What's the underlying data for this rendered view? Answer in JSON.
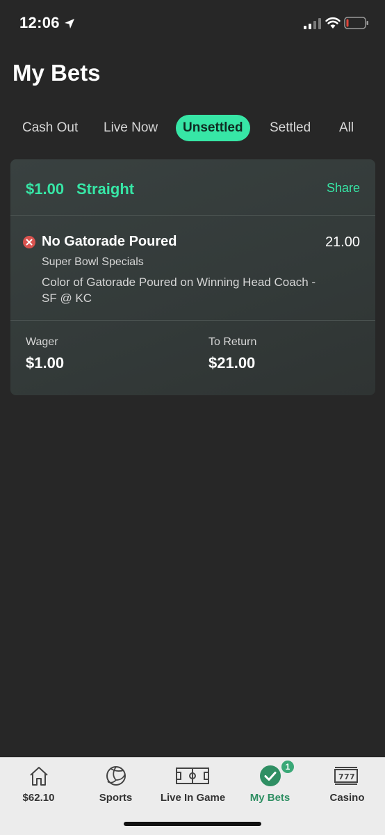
{
  "status_bar": {
    "time": "12:06",
    "icons": [
      "location-arrow-icon",
      "cellular-signal-icon",
      "wifi-icon",
      "battery-low-icon"
    ]
  },
  "page": {
    "title": "My Bets"
  },
  "tabs": [
    {
      "label": "Cash Out",
      "active": false
    },
    {
      "label": "Live Now",
      "active": false
    },
    {
      "label": "Unsettled",
      "active": true
    },
    {
      "label": "Settled",
      "active": false
    },
    {
      "label": "All",
      "active": false
    }
  ],
  "bet": {
    "stake": "$1.00",
    "type": "Straight",
    "share_label": "Share",
    "selection": {
      "status_icon": "lost-x-icon",
      "name": "No Gatorade Poured",
      "odds": "21.00",
      "league": "Super Bowl Specials",
      "market": "Color of Gatorade Poured on Winning Head Coach - SF @ KC"
    },
    "wager_label": "Wager",
    "wager_value": "$1.00",
    "return_label": "To Return",
    "return_value": "$21.00"
  },
  "nav": {
    "items": [
      {
        "label": "$62.10",
        "icon": "home-icon"
      },
      {
        "label": "Sports",
        "icon": "volleyball-icon"
      },
      {
        "label": "Live In Game",
        "icon": "soccer-field-icon"
      },
      {
        "label": "My Bets",
        "icon": "checkmark-circle-icon",
        "active": true,
        "badge": "1"
      },
      {
        "label": "Casino",
        "icon": "slot-machine-icon"
      }
    ]
  },
  "colors": {
    "accent": "#37e6a6",
    "background": "#272727",
    "card": "#363d3c",
    "lost": "#d9534f",
    "nav_active": "#2f8f63"
  }
}
